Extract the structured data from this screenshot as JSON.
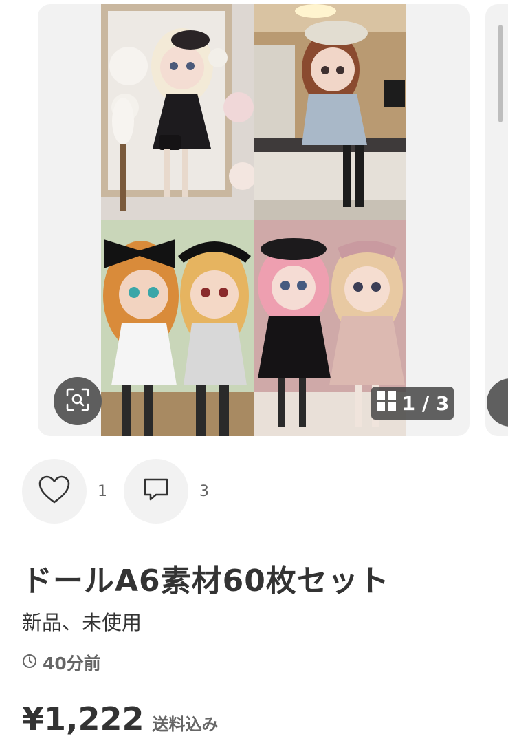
{
  "gallery": {
    "counter_text": "1 / 3",
    "images": [
      {
        "icon": "doll-black-dress-photo"
      },
      {
        "icon": "doll-beret-tweed-photo"
      },
      {
        "icon": "dolls-bow-checkered-photo"
      },
      {
        "icon": "dolls-pink-black-dress-photo"
      }
    ]
  },
  "actions": {
    "like_count": "1",
    "comment_count": "3"
  },
  "item": {
    "title": "ドールA6素材60枚セット",
    "condition": "新品、未使用",
    "posted": "40分前",
    "price": "¥1,222",
    "shipping": "送料込み"
  },
  "colors": {
    "card_bg": "#f2f2f2",
    "overlay_dark": "#5e5e5e",
    "text_main": "#333333",
    "text_sub": "#666666"
  }
}
